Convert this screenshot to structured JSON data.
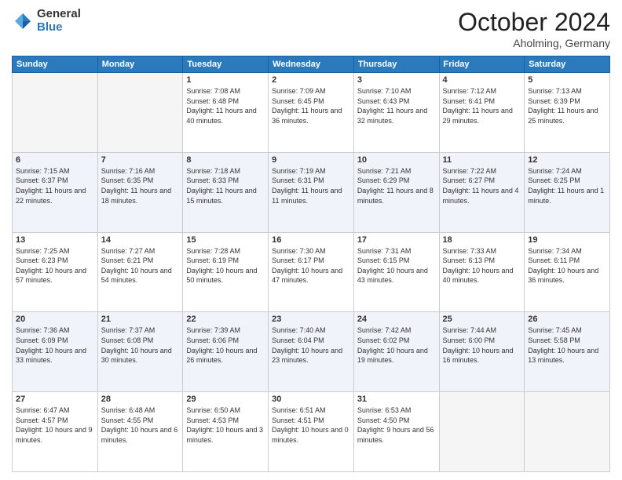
{
  "header": {
    "logo_general": "General",
    "logo_blue": "Blue",
    "month": "October 2024",
    "location": "Aholming, Germany"
  },
  "weekdays": [
    "Sunday",
    "Monday",
    "Tuesday",
    "Wednesday",
    "Thursday",
    "Friday",
    "Saturday"
  ],
  "weeks": [
    [
      {
        "day": "",
        "sunrise": "",
        "sunset": "",
        "daylight": ""
      },
      {
        "day": "",
        "sunrise": "",
        "sunset": "",
        "daylight": ""
      },
      {
        "day": "1",
        "sunrise": "Sunrise: 7:08 AM",
        "sunset": "Sunset: 6:48 PM",
        "daylight": "Daylight: 11 hours and 40 minutes."
      },
      {
        "day": "2",
        "sunrise": "Sunrise: 7:09 AM",
        "sunset": "Sunset: 6:45 PM",
        "daylight": "Daylight: 11 hours and 36 minutes."
      },
      {
        "day": "3",
        "sunrise": "Sunrise: 7:10 AM",
        "sunset": "Sunset: 6:43 PM",
        "daylight": "Daylight: 11 hours and 32 minutes."
      },
      {
        "day": "4",
        "sunrise": "Sunrise: 7:12 AM",
        "sunset": "Sunset: 6:41 PM",
        "daylight": "Daylight: 11 hours and 29 minutes."
      },
      {
        "day": "5",
        "sunrise": "Sunrise: 7:13 AM",
        "sunset": "Sunset: 6:39 PM",
        "daylight": "Daylight: 11 hours and 25 minutes."
      }
    ],
    [
      {
        "day": "6",
        "sunrise": "Sunrise: 7:15 AM",
        "sunset": "Sunset: 6:37 PM",
        "daylight": "Daylight: 11 hours and 22 minutes."
      },
      {
        "day": "7",
        "sunrise": "Sunrise: 7:16 AM",
        "sunset": "Sunset: 6:35 PM",
        "daylight": "Daylight: 11 hours and 18 minutes."
      },
      {
        "day": "8",
        "sunrise": "Sunrise: 7:18 AM",
        "sunset": "Sunset: 6:33 PM",
        "daylight": "Daylight: 11 hours and 15 minutes."
      },
      {
        "day": "9",
        "sunrise": "Sunrise: 7:19 AM",
        "sunset": "Sunset: 6:31 PM",
        "daylight": "Daylight: 11 hours and 11 minutes."
      },
      {
        "day": "10",
        "sunrise": "Sunrise: 7:21 AM",
        "sunset": "Sunset: 6:29 PM",
        "daylight": "Daylight: 11 hours and 8 minutes."
      },
      {
        "day": "11",
        "sunrise": "Sunrise: 7:22 AM",
        "sunset": "Sunset: 6:27 PM",
        "daylight": "Daylight: 11 hours and 4 minutes."
      },
      {
        "day": "12",
        "sunrise": "Sunrise: 7:24 AM",
        "sunset": "Sunset: 6:25 PM",
        "daylight": "Daylight: 11 hours and 1 minute."
      }
    ],
    [
      {
        "day": "13",
        "sunrise": "Sunrise: 7:25 AM",
        "sunset": "Sunset: 6:23 PM",
        "daylight": "Daylight: 10 hours and 57 minutes."
      },
      {
        "day": "14",
        "sunrise": "Sunrise: 7:27 AM",
        "sunset": "Sunset: 6:21 PM",
        "daylight": "Daylight: 10 hours and 54 minutes."
      },
      {
        "day": "15",
        "sunrise": "Sunrise: 7:28 AM",
        "sunset": "Sunset: 6:19 PM",
        "daylight": "Daylight: 10 hours and 50 minutes."
      },
      {
        "day": "16",
        "sunrise": "Sunrise: 7:30 AM",
        "sunset": "Sunset: 6:17 PM",
        "daylight": "Daylight: 10 hours and 47 minutes."
      },
      {
        "day": "17",
        "sunrise": "Sunrise: 7:31 AM",
        "sunset": "Sunset: 6:15 PM",
        "daylight": "Daylight: 10 hours and 43 minutes."
      },
      {
        "day": "18",
        "sunrise": "Sunrise: 7:33 AM",
        "sunset": "Sunset: 6:13 PM",
        "daylight": "Daylight: 10 hours and 40 minutes."
      },
      {
        "day": "19",
        "sunrise": "Sunrise: 7:34 AM",
        "sunset": "Sunset: 6:11 PM",
        "daylight": "Daylight: 10 hours and 36 minutes."
      }
    ],
    [
      {
        "day": "20",
        "sunrise": "Sunrise: 7:36 AM",
        "sunset": "Sunset: 6:09 PM",
        "daylight": "Daylight: 10 hours and 33 minutes."
      },
      {
        "day": "21",
        "sunrise": "Sunrise: 7:37 AM",
        "sunset": "Sunset: 6:08 PM",
        "daylight": "Daylight: 10 hours and 30 minutes."
      },
      {
        "day": "22",
        "sunrise": "Sunrise: 7:39 AM",
        "sunset": "Sunset: 6:06 PM",
        "daylight": "Daylight: 10 hours and 26 minutes."
      },
      {
        "day": "23",
        "sunrise": "Sunrise: 7:40 AM",
        "sunset": "Sunset: 6:04 PM",
        "daylight": "Daylight: 10 hours and 23 minutes."
      },
      {
        "day": "24",
        "sunrise": "Sunrise: 7:42 AM",
        "sunset": "Sunset: 6:02 PM",
        "daylight": "Daylight: 10 hours and 19 minutes."
      },
      {
        "day": "25",
        "sunrise": "Sunrise: 7:44 AM",
        "sunset": "Sunset: 6:00 PM",
        "daylight": "Daylight: 10 hours and 16 minutes."
      },
      {
        "day": "26",
        "sunrise": "Sunrise: 7:45 AM",
        "sunset": "Sunset: 5:58 PM",
        "daylight": "Daylight: 10 hours and 13 minutes."
      }
    ],
    [
      {
        "day": "27",
        "sunrise": "Sunrise: 6:47 AM",
        "sunset": "Sunset: 4:57 PM",
        "daylight": "Daylight: 10 hours and 9 minutes."
      },
      {
        "day": "28",
        "sunrise": "Sunrise: 6:48 AM",
        "sunset": "Sunset: 4:55 PM",
        "daylight": "Daylight: 10 hours and 6 minutes."
      },
      {
        "day": "29",
        "sunrise": "Sunrise: 6:50 AM",
        "sunset": "Sunset: 4:53 PM",
        "daylight": "Daylight: 10 hours and 3 minutes."
      },
      {
        "day": "30",
        "sunrise": "Sunrise: 6:51 AM",
        "sunset": "Sunset: 4:51 PM",
        "daylight": "Daylight: 10 hours and 0 minutes."
      },
      {
        "day": "31",
        "sunrise": "Sunrise: 6:53 AM",
        "sunset": "Sunset: 4:50 PM",
        "daylight": "Daylight: 9 hours and 56 minutes."
      },
      {
        "day": "",
        "sunrise": "",
        "sunset": "",
        "daylight": ""
      },
      {
        "day": "",
        "sunrise": "",
        "sunset": "",
        "daylight": ""
      }
    ]
  ]
}
